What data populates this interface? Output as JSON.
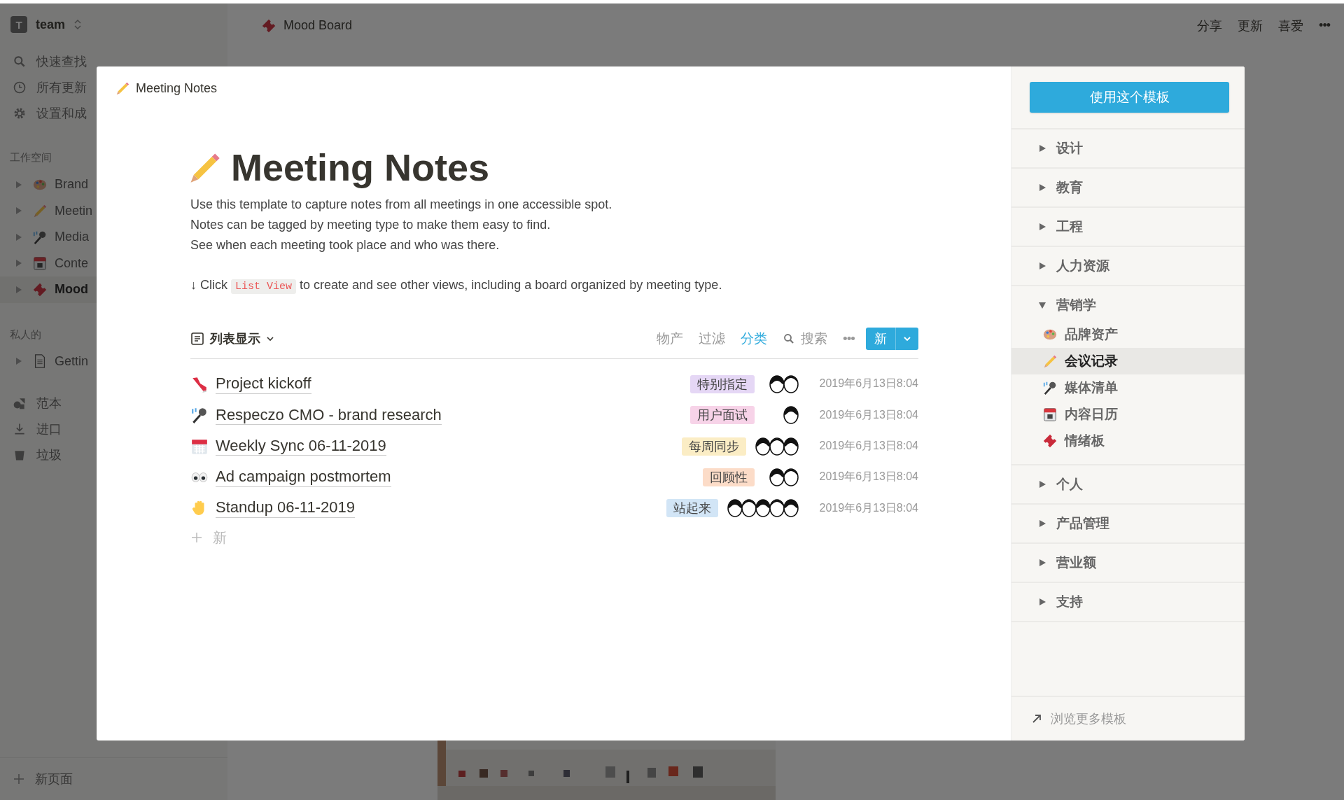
{
  "workspace": {
    "name": "team",
    "initial": "T"
  },
  "sidebar": {
    "nav": [
      "快速查找",
      "所有更新",
      "设置和成"
    ],
    "sections": [
      {
        "title": "工作空间",
        "items": [
          {
            "label": "Brand",
            "selected": false
          },
          {
            "label": "Meetin",
            "selected": false
          },
          {
            "label": "Media",
            "selected": false
          },
          {
            "label": "Conte",
            "selected": false
          },
          {
            "label": "Mood",
            "selected": true
          }
        ]
      },
      {
        "title": "私人的",
        "items": [
          {
            "label": "Gettin",
            "selected": false
          }
        ]
      }
    ],
    "tools": [
      "范本",
      "进口",
      "垃圾"
    ],
    "new_page": "新页面"
  },
  "topbar": {
    "breadcrumb": "Mood Board",
    "actions": [
      "分享",
      "更新",
      "喜爱"
    ],
    "more": "•••"
  },
  "modal": {
    "header": "Meeting Notes",
    "title": "Meeting Notes",
    "description": [
      "Use this template to capture notes from all meetings in one accessible spot.",
      "Notes can be tagged by meeting type to make them easy to find.",
      "See when each meeting took place and who was there."
    ],
    "hint": {
      "arrow": "↓ Click",
      "code": "List View",
      "text": "to create and see other views, including a board organized by meeting type."
    },
    "view": {
      "label": "列表显示"
    },
    "toolbar": [
      {
        "label": "物产",
        "active": false
      },
      {
        "label": "过滤",
        "active": false
      },
      {
        "label": "分类",
        "active": true
      }
    ],
    "search": "搜索",
    "more": "•••",
    "new_button": "新",
    "rows": [
      {
        "title": "Project kickoff",
        "tag": "特别指定",
        "color": "#e5d7f5",
        "date": "2019年6月13日8:04",
        "attendees": [
          {
            "kind": "avatar"
          },
          {
            "kind": "avatar"
          }
        ]
      },
      {
        "title": "Respeczo CMO - brand research",
        "tag": "用户面试",
        "color": "#f7d3e8",
        "date": "2019年6月13日8:04",
        "attendees": [
          {
            "kind": "avatar"
          }
        ]
      },
      {
        "title": "Weekly Sync 06-11-2019",
        "tag": "每周同步",
        "color": "#fbedc5",
        "date": "2019年6月13日8:04",
        "attendees": [
          {
            "kind": "avatar"
          },
          {
            "kind": "avatar"
          },
          {
            "kind": "avatar"
          }
        ]
      },
      {
        "title": "Ad campaign postmortem",
        "tag": "回顾性",
        "color": "#fcdcc8",
        "date": "2019年6月13日8:04",
        "attendees": [
          {
            "kind": "avatar"
          },
          {
            "kind": "avatar"
          }
        ]
      },
      {
        "title": "Standup 06-11-2019",
        "tag": "站起来",
        "color": "#d2e5f6",
        "date": "2019年6月13日8:04",
        "attendees": [
          {
            "kind": "avatar"
          },
          {
            "kind": "avatar"
          },
          {
            "kind": "avatar"
          },
          {
            "kind": "avatar"
          },
          {
            "kind": "avatar"
          }
        ]
      }
    ],
    "add_row": "新"
  },
  "templates": {
    "button": "使用这个模板",
    "categories": [
      {
        "label": "设计",
        "expanded": false
      },
      {
        "label": "教育",
        "expanded": false
      },
      {
        "label": "工程",
        "expanded": false
      },
      {
        "label": "人力资源",
        "expanded": false
      },
      {
        "label": "营销学",
        "expanded": true,
        "children": [
          {
            "label": "品牌资产",
            "selected": false
          },
          {
            "label": "会议记录",
            "selected": true
          },
          {
            "label": "媒体清单",
            "selected": false
          },
          {
            "label": "内容日历",
            "selected": false
          },
          {
            "label": "情绪板",
            "selected": false
          }
        ]
      },
      {
        "label": "个人",
        "expanded": false
      },
      {
        "label": "产品管理",
        "expanded": false
      },
      {
        "label": "营业额",
        "expanded": false
      },
      {
        "label": "支持",
        "expanded": false
      }
    ],
    "browse": "浏览更多模板"
  }
}
